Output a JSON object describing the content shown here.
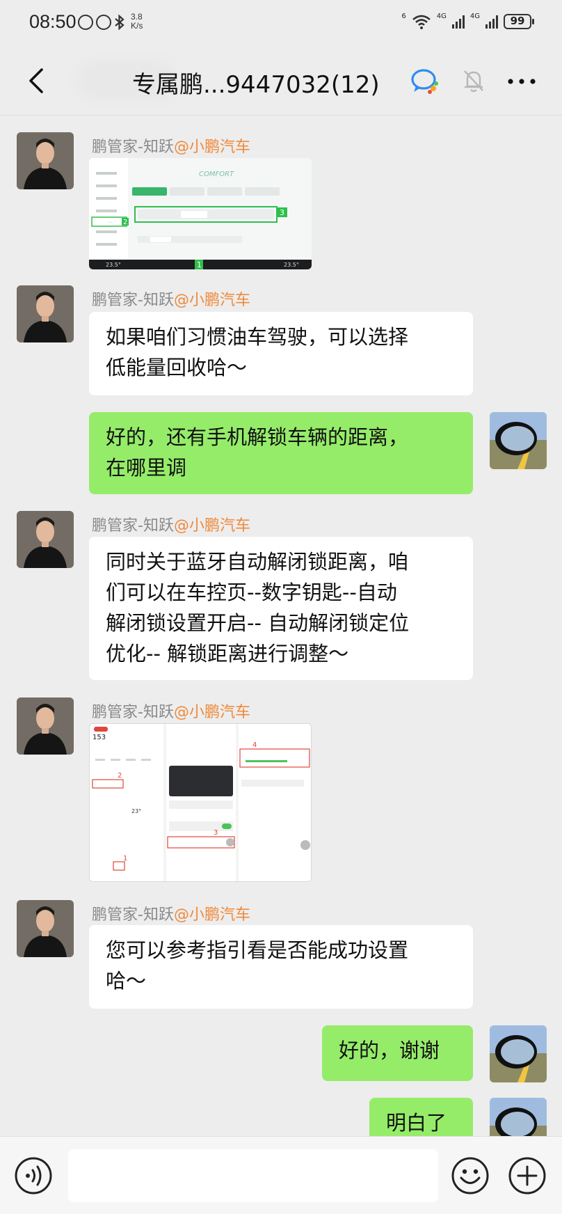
{
  "status_bar": {
    "time": "08:50",
    "net_speed_value": "3.8",
    "net_speed_unit": "K/s",
    "wifi_badge": "6",
    "sim1_label": "4G",
    "sim2_label": "4G",
    "battery": "99"
  },
  "header": {
    "title": "专属鹏...9447032(12)"
  },
  "messages": [
    {
      "side": "left",
      "sender_name": "鹏管家-知跃",
      "sender_org": "@小鹏汽车",
      "type": "image",
      "image": "car-comfort-settings-screenshot"
    },
    {
      "side": "left",
      "sender_name": "鹏管家-知跃",
      "sender_org": "@小鹏汽车",
      "type": "text",
      "lines": [
        "如果咱们习惯油车驾驶，可以选择",
        "低能量回收哈～"
      ]
    },
    {
      "side": "right",
      "type": "text",
      "lines": [
        "好的，还有手机解锁车辆的距离，",
        "在哪里调"
      ]
    },
    {
      "side": "left",
      "sender_name": "鹏管家-知跃",
      "sender_org": "@小鹏汽车",
      "type": "text",
      "lines": [
        "同时关于蓝牙自动解闭锁距离，咱",
        "们可以在车控页--数字钥匙--自动",
        "解闭锁设置开启-- 自动解闭锁定位",
        "优化-- 解锁距离进行调整～"
      ]
    },
    {
      "side": "left",
      "sender_name": "鹏管家-知跃",
      "sender_org": "@小鹏汽车",
      "type": "image",
      "image": "digital-key-steps-screenshot"
    },
    {
      "side": "left",
      "sender_name": "鹏管家-知跃",
      "sender_org": "@小鹏汽车",
      "type": "text",
      "lines": [
        "您可以参考指引看是否能成功设置",
        "哈～"
      ]
    },
    {
      "side": "right",
      "type": "text",
      "lines": [
        "好的，谢谢"
      ]
    },
    {
      "side": "right",
      "type": "text",
      "lines": [
        "明白了"
      ]
    }
  ],
  "thumb1": {
    "brand": "COMFORT",
    "temp_left": "23.5°",
    "temp_right": "23.5°",
    "step_labels": [
      "1",
      "2",
      "3"
    ]
  },
  "thumb2": {
    "step_labels": [
      "1",
      "2",
      "3",
      "4"
    ],
    "range_value": "153",
    "temp": "23°"
  },
  "colors": {
    "bubble_green": "#95ec69",
    "bubble_white": "#ffffff",
    "org_orange": "#ef8a3b",
    "highlight_green": "#2fbf4c",
    "highlight_red": "#e0473a"
  }
}
